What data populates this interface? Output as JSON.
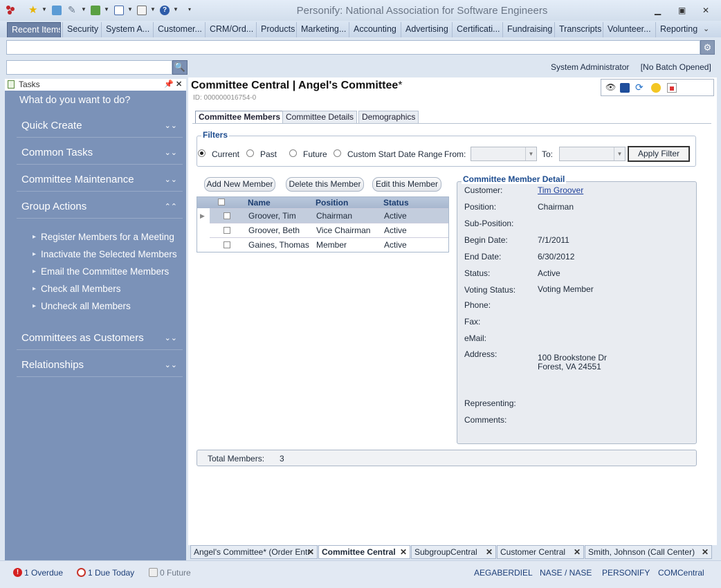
{
  "window": {
    "title": "Personify: National Association for Software Engineers"
  },
  "nav_tabs": [
    "Recent Items",
    "Security",
    "System A...",
    "Customer...",
    "CRM/Ord...",
    "Products",
    "Marketing...",
    "Accounting",
    "Advertising",
    "Certificati...",
    "Fundraising",
    "Transcripts",
    "Volunteer...",
    "Reporting"
  ],
  "header": {
    "user": "System Administrator",
    "batch": "[No Batch Opened]"
  },
  "tasks": {
    "title": "Tasks",
    "prompt": "What do you want to do?",
    "sections": [
      "Quick Create",
      "Common Tasks",
      "Committee Maintenance",
      "Group Actions"
    ],
    "group_actions": [
      "Register Members for a Meeting",
      "Inactivate the Selected Members",
      "Email the Committee Members",
      "Check all Members",
      "Uncheck all Members"
    ],
    "sections_after": [
      "Committees as Customers",
      "Relationships"
    ]
  },
  "page": {
    "title": "Committee Central  |  Angel's Committee",
    "dirty_mark": "*",
    "id_line": "ID: 000000016754-0"
  },
  "subtabs": [
    "Committee Members",
    "Committee Details",
    "Demographics"
  ],
  "filters": {
    "legend": "Filters",
    "options": [
      "Current",
      "Past",
      "Future",
      "Custom Start Date Range"
    ],
    "selected": "Current",
    "from_label": "From:",
    "to_label": "To:",
    "apply_label": "Apply Filter"
  },
  "actions": [
    "Add New Member",
    "Delete this Member",
    "Edit this Member"
  ],
  "grid": {
    "columns": [
      "Name",
      "Position",
      "Status"
    ],
    "rows": [
      {
        "name": "Groover, Tim",
        "position": "Chairman",
        "status": "Active"
      },
      {
        "name": "Groover, Beth",
        "position": "Vice Chairman",
        "status": "Active"
      },
      {
        "name": "Gaines, Thomas",
        "position": "Member",
        "status": "Active"
      }
    ]
  },
  "detail": {
    "legend": "Committee Member Detail",
    "fields": [
      {
        "label": "Customer:",
        "value": "Tim Groover"
      },
      {
        "label": "Position:",
        "value": "Chairman"
      },
      {
        "label": "Sub-Position:",
        "value": ""
      },
      {
        "label": "Begin Date:",
        "value": "7/1/2011"
      },
      {
        "label": "End Date:",
        "value": "6/30/2012"
      },
      {
        "label": "Status:",
        "value": "Active"
      },
      {
        "label": "Voting Status:",
        "value": "Voting Member"
      },
      {
        "label": "Phone:",
        "value": ""
      },
      {
        "label": "Fax:",
        "value": ""
      },
      {
        "label": "eMail:",
        "value": ""
      },
      {
        "label": "Address:",
        "value": "100 Brookstone Dr"
      },
      {
        "label": "Representing:",
        "value": ""
      },
      {
        "label": "Comments:",
        "value": ""
      }
    ],
    "address_line2": "Forest, VA 24551"
  },
  "totals": {
    "label": "Total Members:",
    "value": "3"
  },
  "window_tabs": [
    "Angel's Committee* (Order Entr",
    "Committee Central",
    "SubgroupCentral",
    "Customer Central",
    "Smith, Johnson (Call Center)"
  ],
  "status": {
    "overdue": "1 Overdue",
    "due_today": "1 Due Today",
    "future": "0 Future",
    "user": "AEGABERDIEL",
    "org": "NASE / NASE",
    "app": "PERSONIFY",
    "module": "COMCentral"
  },
  "colors": {
    "task_panel": "#7b92b8",
    "nav_active": "#6d82a6",
    "legend_blue": "#1d4c8f",
    "overdue_red": "#d42020"
  }
}
